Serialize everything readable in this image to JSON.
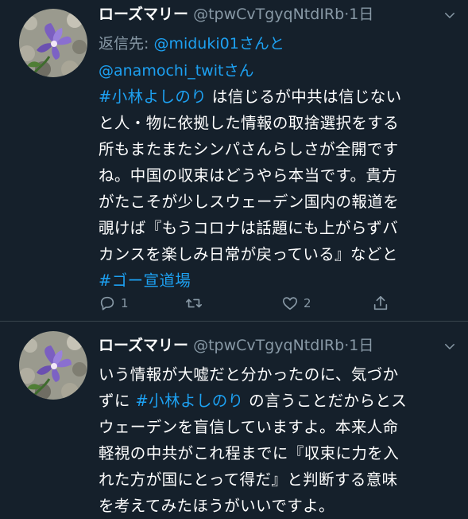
{
  "tweets": [
    {
      "name": "ローズマリー",
      "handle": "@tpwCvTgyqNtdIRb",
      "separator": "·",
      "time": "1日",
      "reply_prefix": "返信先: ",
      "reply_to_1": "@miduki01",
      "reply_and": "さんと",
      "reply_to_2": "@anamochi_twit",
      "reply_suffix": "さん",
      "lines": [
        {
          "pre": "",
          "tag": "#小林よしのり",
          "post": " は信じるが中共は信じない"
        },
        {
          "pre": "と人・物に依拠した情報の取捨選択をする",
          "tag": "",
          "post": ""
        },
        {
          "pre": "所もまたまたシンパさんらしさが全開です",
          "tag": "",
          "post": ""
        },
        {
          "pre": "ね。中国の収束はどうやら本当です。貴方",
          "tag": "",
          "post": ""
        },
        {
          "pre": "がたこそが少しスウェーデン国内の報道を",
          "tag": "",
          "post": ""
        },
        {
          "pre": "覗けば『もうコロナは話題にも上がらずバ",
          "tag": "",
          "post": ""
        },
        {
          "pre": "カンスを楽しみ日常が戻っている』などと",
          "tag": "",
          "post": ""
        },
        {
          "pre": "",
          "tag": "#ゴー宣道場",
          "post": ""
        }
      ],
      "reply_count": "1",
      "retweet_count": "",
      "like_count": "2"
    },
    {
      "name": "ローズマリー",
      "handle": "@tpwCvTgyqNtdIRb",
      "separator": "·",
      "time": "1日",
      "lines": [
        {
          "pre": "いう情報が大嘘だと分かったのに、気づか",
          "tag": "",
          "post": ""
        },
        {
          "pre": "ずに ",
          "tag": "#小林よしのり",
          "post": " の言うことだからとス"
        },
        {
          "pre": "ウェーデンを盲信していますよ。本来人命",
          "tag": "",
          "post": ""
        },
        {
          "pre": "軽視の中共がこれ程までに『収束に力を入",
          "tag": "",
          "post": ""
        },
        {
          "pre": "れた方が国にとって得だ』と判断する意味",
          "tag": "",
          "post": ""
        },
        {
          "pre": "を考えてみたほうがいいですよ。",
          "tag": "",
          "post": ""
        }
      ]
    }
  ],
  "colors": {
    "background": "#15202b",
    "text": "#ffffff",
    "secondary": "#8899a6",
    "link": "#1da1f2",
    "divider": "#38444d"
  },
  "icons": [
    "chevron-down-icon",
    "reply-icon",
    "retweet-icon",
    "like-icon",
    "share-icon"
  ]
}
